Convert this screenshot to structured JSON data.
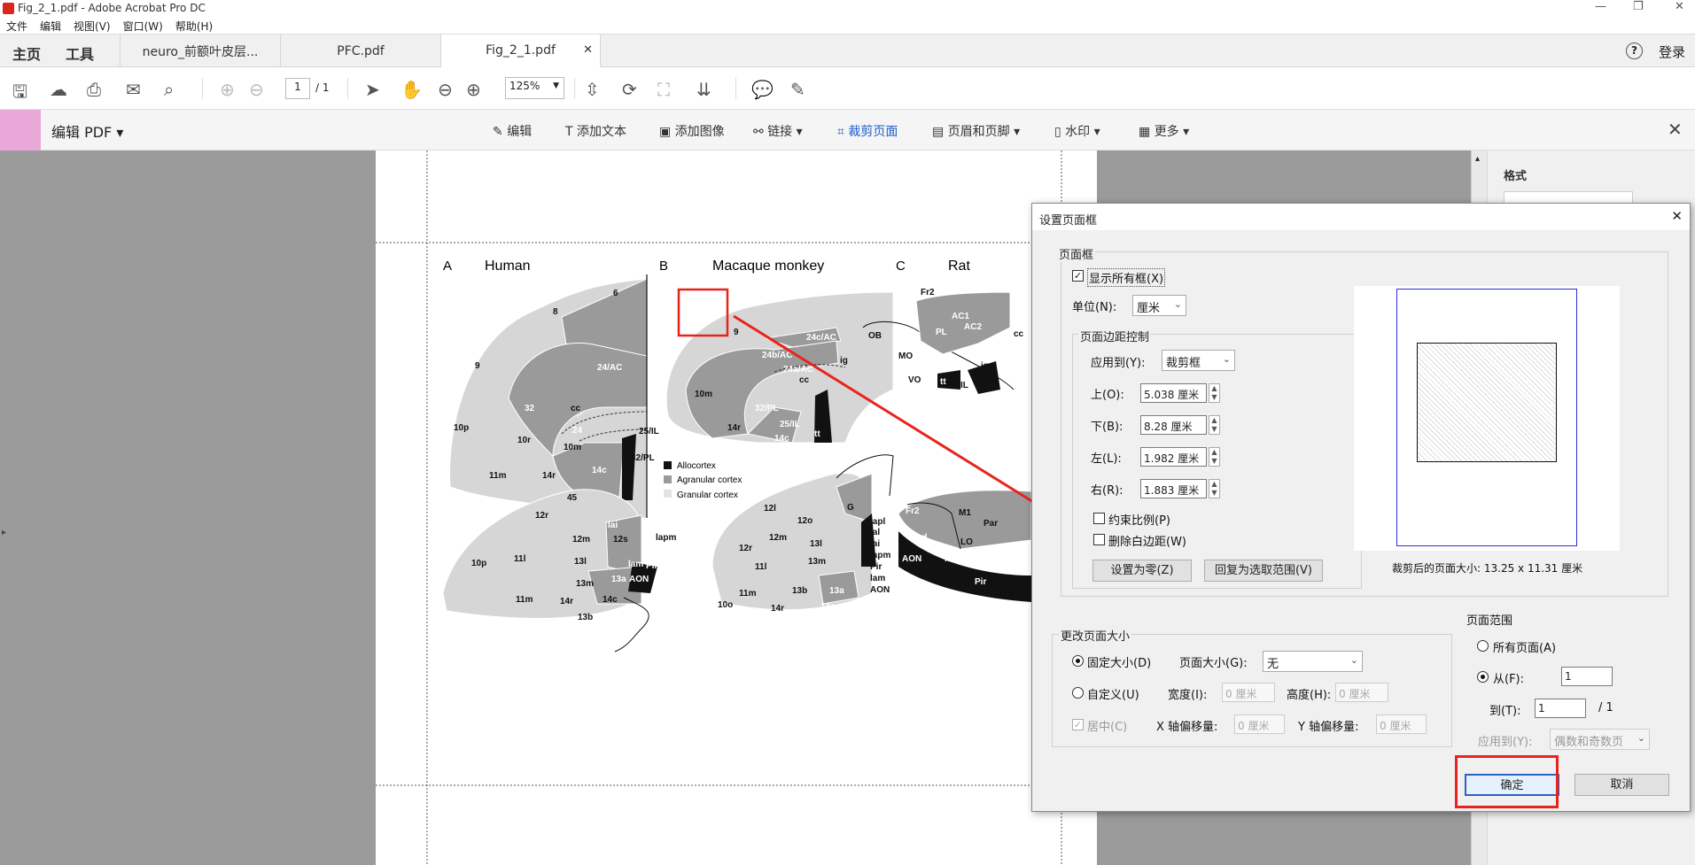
{
  "window": {
    "title": "Fig_2_1.pdf - Adobe Acrobat Pro DC",
    "controls": [
      "—",
      "❐",
      "✕"
    ]
  },
  "menu": [
    "文件",
    "编辑",
    "视图(V)",
    "窗口(W)",
    "帮助(H)"
  ],
  "tabs": {
    "home": "主页",
    "tools": "工具",
    "docs": [
      "neuro_前额叶皮层...",
      "PFC.pdf",
      "Fig_2_1.pdf"
    ],
    "help": "?",
    "login": "登录"
  },
  "toolbar": {
    "page_current": "1",
    "page_total": "/ 1",
    "zoom": "125%"
  },
  "edit_bar": {
    "title": "编辑 PDF",
    "items": [
      "编辑",
      "添加文本",
      "添加图像",
      "链接",
      "裁剪页面",
      "页眉和页脚",
      "水印",
      "更多"
    ]
  },
  "right_panel": {
    "title": "格式"
  },
  "figure": {
    "panels": [
      {
        "letter": "A",
        "name": "Human"
      },
      {
        "letter": "B",
        "name": "Macaque monkey"
      },
      {
        "letter": "C",
        "name": "Rat"
      }
    ],
    "legend": [
      "Allocortex",
      "Agranular cortex",
      "Granular cortex"
    ],
    "human_top": [
      "6",
      "8",
      "9",
      "24/AC",
      "32",
      "cc",
      "24",
      "10p",
      "10r",
      "10m",
      "25/IL",
      "32/PL",
      "11m",
      "14r",
      "14c"
    ],
    "monkey_top": [
      "9",
      "24c/AC",
      "24b/AC",
      "24a/AC",
      "ig",
      "cc",
      "10m",
      "32/PL",
      "14r",
      "25/IL",
      "14c",
      "tt"
    ],
    "rat_top": [
      "Fr2",
      "AC1",
      "PL",
      "AC2",
      "OB",
      "MO",
      "VO",
      "tt",
      "IL",
      "ig",
      "cc"
    ],
    "human_bottom": [
      "45",
      "12r",
      "lai",
      "12s",
      "lapm",
      "12m",
      "10p",
      "11l",
      "13l",
      "lam",
      "Pir",
      "AON",
      "13m",
      "13a",
      "11m",
      "14r",
      "14c",
      "13b"
    ],
    "monkey_bottom": [
      "12l",
      "12o",
      "G",
      "lapl",
      "lal",
      "lai",
      "lapm",
      "Pir",
      "lam",
      "AON",
      "12m",
      "13l",
      "12r",
      "11l",
      "13m",
      "13b",
      "13a",
      "11m",
      "10o",
      "14r",
      "14c"
    ],
    "rat_bottom": [
      "Fr2",
      "M1",
      "Par",
      "lad",
      "LO",
      "AON",
      "lav",
      "lap",
      "Pir"
    ]
  },
  "dialog": {
    "title": "设置页面框",
    "group_page_box": "页面框",
    "show_all_boxes": "显示所有框(X)",
    "unit_label": "单位(N):",
    "unit_value": "厘米",
    "margin_group": "页面边距控制",
    "apply_label": "应用到(Y):",
    "apply_value": "裁剪框",
    "margins": [
      {
        "label": "上(O):",
        "value": "5.038 厘米"
      },
      {
        "label": "下(B):",
        "value": "8.28 厘米"
      },
      {
        "label": "左(L):",
        "value": "1.982 厘米"
      },
      {
        "label": "右(R):",
        "value": "1.883 厘米"
      }
    ],
    "constrain": "约束比例(P)",
    "remove_white": "删除白边距(W)",
    "set_zero": "设置为零(Z)",
    "revert": "回复为选取范围(V)",
    "cropped_size": "裁剪后的页面大小: 13.25 x 11.31 厘米",
    "change_size_group": "更改页面大小",
    "fixed_size": "固定大小(D)",
    "page_size_label": "页面大小(G):",
    "page_size_value": "无",
    "custom": "自定义(U)",
    "width_label": "宽度(I):",
    "width_value": "0 厘米",
    "height_label": "高度(H):",
    "height_value": "0 厘米",
    "center": "居中(C)",
    "x_offset_label": "X 轴偏移量:",
    "x_offset_value": "0 厘米",
    "y_offset_label": "Y 轴偏移量:",
    "y_offset_value": "0 厘米",
    "range_group": "页面范围",
    "all_pages": "所有页面(A)",
    "from_label": "从(F):",
    "from_value": "1",
    "to_label": "到(T):",
    "to_value": "1",
    "to_total": "/ 1",
    "apply_to_label": "应用到(Y):",
    "apply_to_value": "偶数和奇数页",
    "ok": "确定",
    "cancel": "取消"
  },
  "colors": {
    "annotation": "#e8231d",
    "pink": "#e8a8d8",
    "selection": "#2a62c9"
  }
}
